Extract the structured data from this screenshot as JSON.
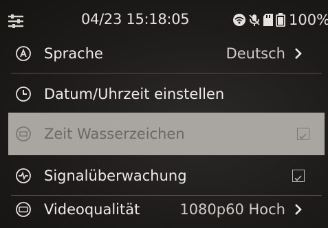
{
  "status_bar": {
    "datetime": "04/23 15:18:05",
    "battery": "100%",
    "icons": [
      "menu-icon",
      "wifi-icon",
      "microphone-icon",
      "sd-card-icon",
      "battery-icon"
    ]
  },
  "menu": {
    "items": [
      {
        "label": "Sprache",
        "value": "Deutsch",
        "icon": "language-icon",
        "control": "chevron"
      },
      {
        "label": "Datum/Uhrzeit einstellen",
        "icon": "clock-icon",
        "control": "none"
      },
      {
        "label": "Zeit Wasserzeichen",
        "icon": "watermark-icon",
        "control": "checkbox",
        "checked": true,
        "selected": true
      },
      {
        "label": "Signalüberwachung",
        "icon": "signal-monitor-icon",
        "control": "checkbox",
        "checked": true
      },
      {
        "label": "Videoqualität",
        "value": "1080p60 Hoch",
        "icon": "video-quality-icon",
        "control": "chevron"
      }
    ]
  },
  "colors": {
    "background": "#1d1b1a",
    "text": "#efece7",
    "highlight": "#a9a6a1",
    "highlight_text": "#6c6963"
  }
}
